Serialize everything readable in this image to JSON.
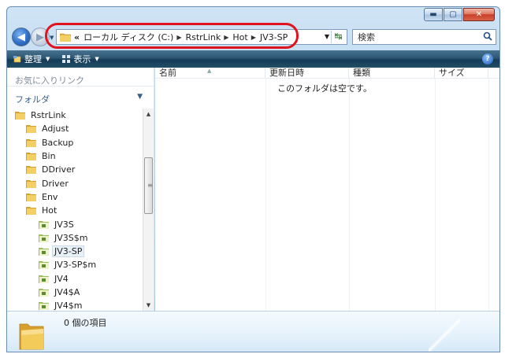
{
  "window": {
    "caption_buttons": [
      "minimize",
      "maximize",
      "close"
    ]
  },
  "nav": {
    "address": {
      "overflow": "«",
      "crumbs": [
        "ローカル ディスク (C:)",
        "RstrLink",
        "Hot",
        "JV3-SP"
      ]
    },
    "search_placeholder": "検索"
  },
  "toolbar": {
    "organize": "整理",
    "view": "表示"
  },
  "left_pane": {
    "favorites": "お気に入りリンク",
    "folders": "フォルダ",
    "tree": [
      {
        "label": "RstrLink",
        "indent": 1,
        "icon": "folder"
      },
      {
        "label": "Adjust",
        "indent": 2,
        "icon": "folder"
      },
      {
        "label": "Backup",
        "indent": 2,
        "icon": "folder"
      },
      {
        "label": "Bin",
        "indent": 2,
        "icon": "folder"
      },
      {
        "label": "DDriver",
        "indent": 2,
        "icon": "folder"
      },
      {
        "label": "Driver",
        "indent": 2,
        "icon": "folder"
      },
      {
        "label": "Env",
        "indent": 2,
        "icon": "folder"
      },
      {
        "label": "Hot",
        "indent": 2,
        "icon": "folder"
      },
      {
        "label": "JV3S",
        "indent": 3,
        "icon": "special-folder"
      },
      {
        "label": "JV3S$m",
        "indent": 3,
        "icon": "special-folder"
      },
      {
        "label": "JV3-SP",
        "indent": 3,
        "icon": "special-folder",
        "selected": true
      },
      {
        "label": "JV3-SP$m",
        "indent": 3,
        "icon": "special-folder"
      },
      {
        "label": "JV4",
        "indent": 3,
        "icon": "special-folder"
      },
      {
        "label": "JV4$A",
        "indent": 3,
        "icon": "special-folder"
      },
      {
        "label": "JV4$m",
        "indent": 3,
        "icon": "special-folder"
      }
    ]
  },
  "columns": [
    "名前",
    "更新日時",
    "種類",
    "サイズ"
  ],
  "empty_message": "このフォルダは空です。",
  "details": {
    "item_count": "0 個の項目"
  },
  "colors": {
    "highlight_ring": "#e0141e",
    "toolbar": "#2d5672",
    "folder": "#e8b53a"
  }
}
